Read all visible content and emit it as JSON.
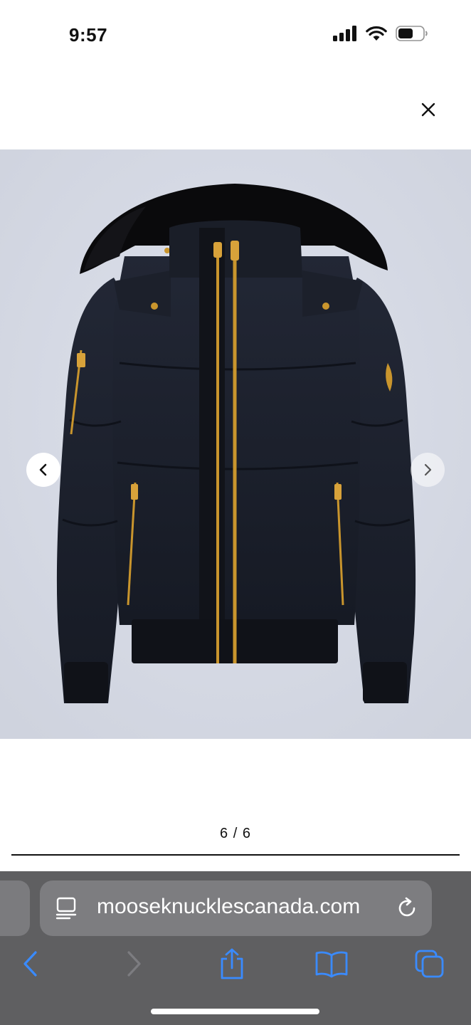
{
  "status_bar": {
    "time": "9:57",
    "icons": [
      "cellular-signal-icon",
      "wifi-icon",
      "battery-icon"
    ]
  },
  "viewer": {
    "close_icon": "close-icon",
    "prev_icon": "chevron-left-icon",
    "next_icon": "chevron-right-icon",
    "counter": "6 / 6",
    "image_subject": "black bomber down jacket with black fur hood and gold zippers"
  },
  "browser": {
    "url": "mooseknucklescanada.com",
    "toolbar": [
      "back-icon",
      "forward-icon",
      "share-icon",
      "bookmarks-icon",
      "tabs-icon"
    ]
  },
  "colors": {
    "accent": "#3a8bff",
    "browser_bar": "#5f5f61",
    "url_field": "#7d7d80",
    "image_bg": "#d7dbe6",
    "jacket": "#1b1f2a",
    "gold": "#c9952d"
  }
}
